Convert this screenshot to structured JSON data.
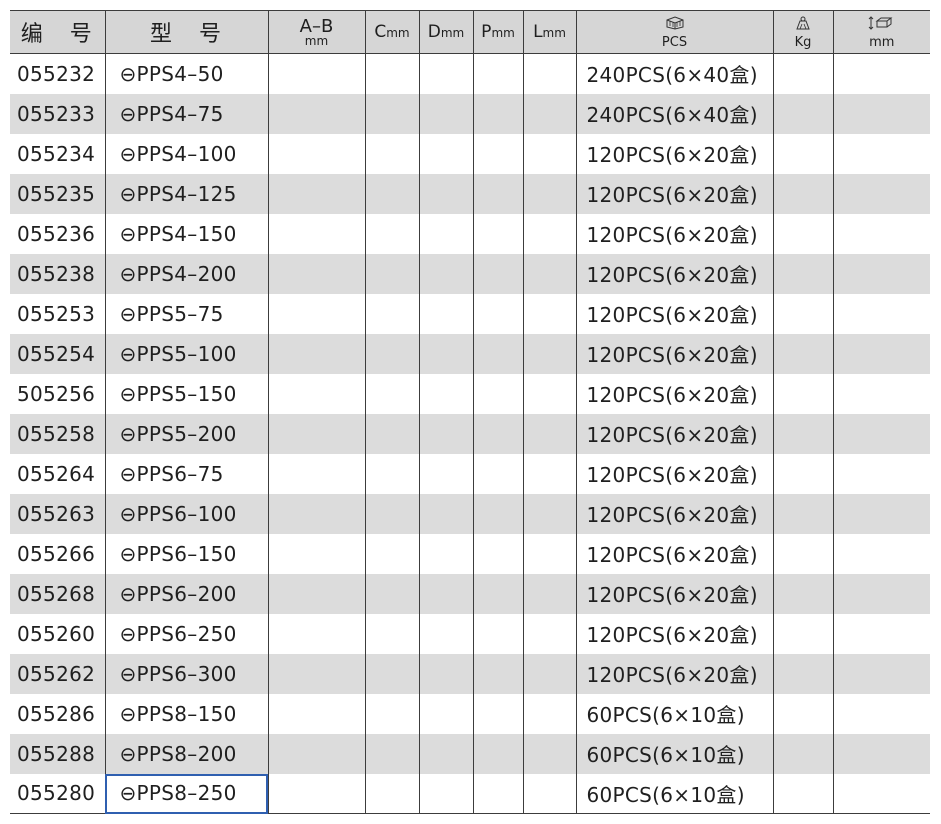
{
  "header": {
    "code": "编 号",
    "model": "型 号",
    "ab_main": "A–B",
    "ab_unit": "mm",
    "c_main": "C",
    "c_unit": "mm",
    "d_main": "D",
    "d_unit": "mm",
    "p_main": "P",
    "p_unit": "mm",
    "l_main": "L",
    "l_unit": "mm",
    "pack_unit": "PCS",
    "weight_unit": "Kg",
    "size_unit": "mm"
  },
  "icons": {
    "pack": "box-icon",
    "weight": "weight-icon",
    "size": "carton-size-icon"
  },
  "colors": {
    "header_bg": "#d6d6d6",
    "stripe_bg": "#dcdcdc",
    "selection": "#2f5fb0"
  },
  "rows": [
    {
      "code": "055232",
      "model": "⊖PPS4–50",
      "pack": "240PCS(6×40盒)"
    },
    {
      "code": "055233",
      "model": "⊖PPS4–75",
      "pack": "240PCS(6×40盒)"
    },
    {
      "code": "055234",
      "model": "⊖PPS4–100",
      "pack": "120PCS(6×20盒)"
    },
    {
      "code": "055235",
      "model": "⊖PPS4–125",
      "pack": "120PCS(6×20盒)"
    },
    {
      "code": "055236",
      "model": "⊖PPS4–150",
      "pack": "120PCS(6×20盒)"
    },
    {
      "code": "055238",
      "model": "⊖PPS4–200",
      "pack": "120PCS(6×20盒)"
    },
    {
      "code": "055253",
      "model": "⊖PPS5–75",
      "pack": "120PCS(6×20盒)"
    },
    {
      "code": "055254",
      "model": "⊖PPS5–100",
      "pack": "120PCS(6×20盒)"
    },
    {
      "code": "505256",
      "model": "⊖PPS5–150",
      "pack": "120PCS(6×20盒)"
    },
    {
      "code": "055258",
      "model": "⊖PPS5–200",
      "pack": "120PCS(6×20盒)"
    },
    {
      "code": "055264",
      "model": "⊖PPS6–75",
      "pack": "120PCS(6×20盒)"
    },
    {
      "code": "055263",
      "model": "⊖PPS6–100",
      "pack": "120PCS(6×20盒)"
    },
    {
      "code": "055266",
      "model": "⊖PPS6–150",
      "pack": "120PCS(6×20盒)"
    },
    {
      "code": "055268",
      "model": "⊖PPS6–200",
      "pack": "120PCS(6×20盒)"
    },
    {
      "code": "055260",
      "model": "⊖PPS6–250",
      "pack": "120PCS(6×20盒)"
    },
    {
      "code": "055262",
      "model": "⊖PPS6–300",
      "pack": "120PCS(6×20盒)"
    },
    {
      "code": "055286",
      "model": "⊖PPS8–150",
      "pack": "60PCS(6×10盒)"
    },
    {
      "code": "055288",
      "model": "⊖PPS8–200",
      "pack": "60PCS(6×10盒)"
    },
    {
      "code": "055280",
      "model": "⊖PPS8–250",
      "pack": "60PCS(6×10盒)"
    }
  ]
}
